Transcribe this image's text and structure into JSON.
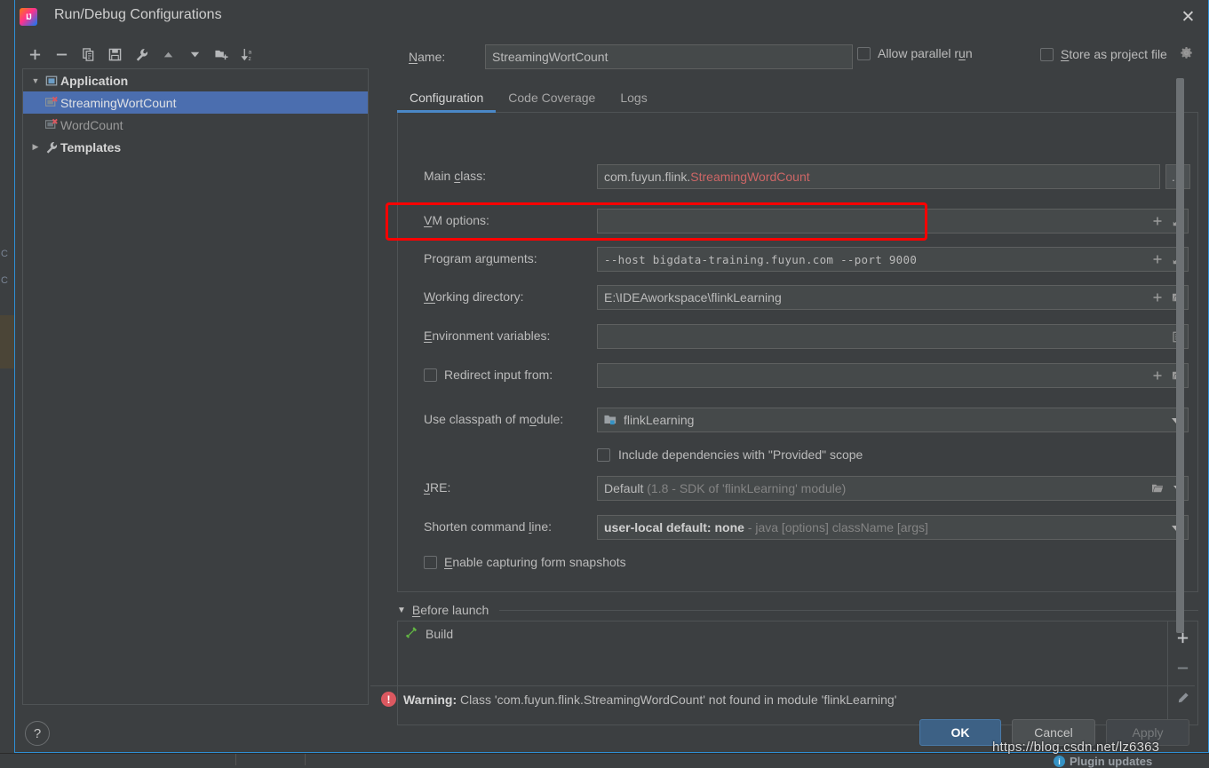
{
  "window": {
    "title": "Run/Debug Configurations",
    "close_label": "✕",
    "app_icon": "intellij-idea-icon"
  },
  "left_toolbar": {
    "buttons": [
      {
        "name": "add-configuration",
        "icon": "plus-icon"
      },
      {
        "name": "remove-configuration",
        "icon": "minus-icon"
      },
      {
        "name": "copy-configuration",
        "icon": "copy-icon"
      },
      {
        "name": "save-configuration",
        "icon": "save-icon"
      },
      {
        "name": "edit-templates",
        "icon": "wrench-icon"
      },
      {
        "name": "move-up",
        "icon": "arrow-up-icon"
      },
      {
        "name": "move-down",
        "icon": "arrow-down-icon"
      },
      {
        "name": "create-folder",
        "icon": "folder-add-icon"
      },
      {
        "name": "sort-alphabetically",
        "icon": "sort-az-icon"
      }
    ]
  },
  "tree": {
    "nodes": [
      {
        "label": "Application",
        "icon": "application-icon",
        "expanded": true,
        "level": 0,
        "bold": true
      },
      {
        "label": "StreamingWortCount",
        "icon": "config-error-icon",
        "level": 1,
        "selected": true
      },
      {
        "label": "WordCount",
        "icon": "config-error-icon",
        "level": 1,
        "selected": false
      },
      {
        "label": "Templates",
        "icon": "wrench-icon",
        "expanded": false,
        "level": 0,
        "bold": true
      }
    ]
  },
  "header": {
    "name_label": "Name:",
    "name_value": "StreamingWortCount",
    "allow_parallel_run_label": "Allow parallel run",
    "allow_parallel_run_checked": false,
    "store_as_project_file_label": "Store as project file",
    "store_as_project_file_checked": false,
    "gear_icon": "gear-icon"
  },
  "tabs": [
    {
      "label": "Configuration",
      "active": true
    },
    {
      "label": "Code Coverage",
      "active": false
    },
    {
      "label": "Logs",
      "active": false
    }
  ],
  "form": {
    "main_class": {
      "label": "Main class:",
      "value_prefix": "com.fuyun.flink.",
      "value_error": "StreamingWordCount",
      "browse_label": "...",
      "error_color": "#cc6666"
    },
    "vm_options": {
      "label": "VM options:",
      "value": "",
      "expand_icon": "expand-icon",
      "macro_icon": "plus-icon"
    },
    "program_arguments": {
      "label": "Program arguments:",
      "value": "--host bigdata-training.fuyun.com --port 9000",
      "expand_icon": "expand-icon",
      "macro_icon": "plus-icon",
      "highlight_color": "#ff0000"
    },
    "working_directory": {
      "label": "Working directory:",
      "value": "E:\\IDEAworkspace\\flinkLearning",
      "browse_icon": "folder-icon",
      "macro_icon": "plus-icon"
    },
    "environment_variables": {
      "label": "Environment variables:",
      "value": "",
      "browse_icon": "list-icon"
    },
    "redirect_input": {
      "label": "Redirect input from:",
      "checked": false,
      "value": "",
      "browse_icon": "folder-icon",
      "macro_icon": "plus-icon"
    },
    "classpath_module": {
      "label": "Use classpath of module:",
      "value": "flinkLearning",
      "icon": "module-icon"
    },
    "include_provided": {
      "label": "Include dependencies with \"Provided\" scope",
      "checked": false
    },
    "jre": {
      "label": "JRE:",
      "value": "Default",
      "hint": "(1.8 - SDK of 'flinkLearning' module)",
      "browse_icon": "folder-icon"
    },
    "shorten_command_line": {
      "label": "Shorten command line:",
      "value": "user-local default: none",
      "hint": "- java [options] className [args]"
    },
    "form_snapshots": {
      "label": "Enable capturing form snapshots",
      "checked": false
    }
  },
  "before_launch": {
    "title": "Before launch",
    "expanded": true,
    "items": [
      {
        "label": "Build",
        "icon": "hammer-icon"
      }
    ],
    "side_buttons": [
      {
        "name": "add-task-button",
        "icon": "plus-icon"
      },
      {
        "name": "remove-task-button",
        "icon": "minus-icon"
      },
      {
        "name": "edit-task-button",
        "icon": "pencil-icon"
      }
    ]
  },
  "warning": {
    "icon": "error-icon",
    "prefix": "Warning:",
    "message": "Class 'com.fuyun.flink.StreamingWordCount' not found in module 'flinkLearning'"
  },
  "footer": {
    "help_label": "?",
    "ok_label": "OK",
    "cancel_label": "Cancel",
    "apply_label": "Apply",
    "apply_disabled": true
  },
  "watermark": {
    "text": "https://blog.csdn.net/lz6363"
  },
  "status_bar": {
    "plugin_update_label": "Plugin updates",
    "plugin_update_icon": "info-icon"
  },
  "background": {
    "ghost_chars": [
      "C",
      "C"
    ]
  }
}
